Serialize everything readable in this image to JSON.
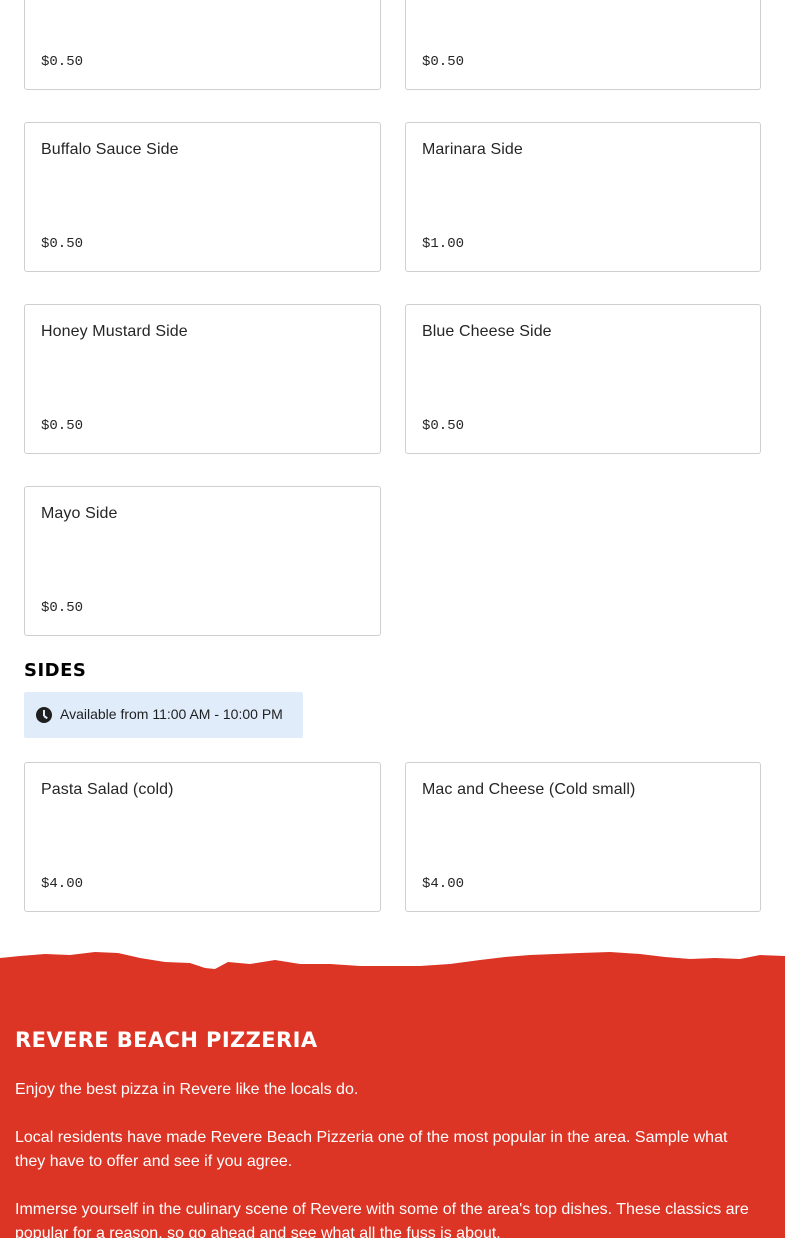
{
  "colors": {
    "footer_red": "#dc3425",
    "availability_bg": "#e1ecfb",
    "card_border": "#cfcfcf"
  },
  "items": [
    {
      "name": "",
      "price": "$0.50"
    },
    {
      "name": "",
      "price": "$0.50"
    },
    {
      "name": "Buffalo Sauce Side",
      "price": "$0.50"
    },
    {
      "name": "Marinara Side",
      "price": "$1.00"
    },
    {
      "name": "Honey Mustard Side",
      "price": "$0.50"
    },
    {
      "name": "Blue Cheese Side",
      "price": "$0.50"
    },
    {
      "name": "Mayo Side",
      "price": "$0.50"
    }
  ],
  "sides": {
    "title": "SIDES",
    "availability_icon": "clock-icon",
    "availability": "Available from 11:00 AM - 10:00 PM",
    "items": [
      {
        "name": "Pasta Salad (cold)",
        "price": "$4.00"
      },
      {
        "name": "Mac and Cheese (Cold small)",
        "price": "$4.00"
      }
    ]
  },
  "footer": {
    "title": "REVERE BEACH PIZZERIA",
    "paragraphs": [
      "Enjoy the best pizza in Revere like the locals do.",
      "Local residents have made Revere Beach Pizzeria one of the most popular in the area. Sample what they have to offer and see if you agree.",
      "Immerse yourself in the culinary scene of Revere with some of the area's top dishes. These classics are popular for a reason, so go ahead and see what all the fuss is about."
    ]
  }
}
